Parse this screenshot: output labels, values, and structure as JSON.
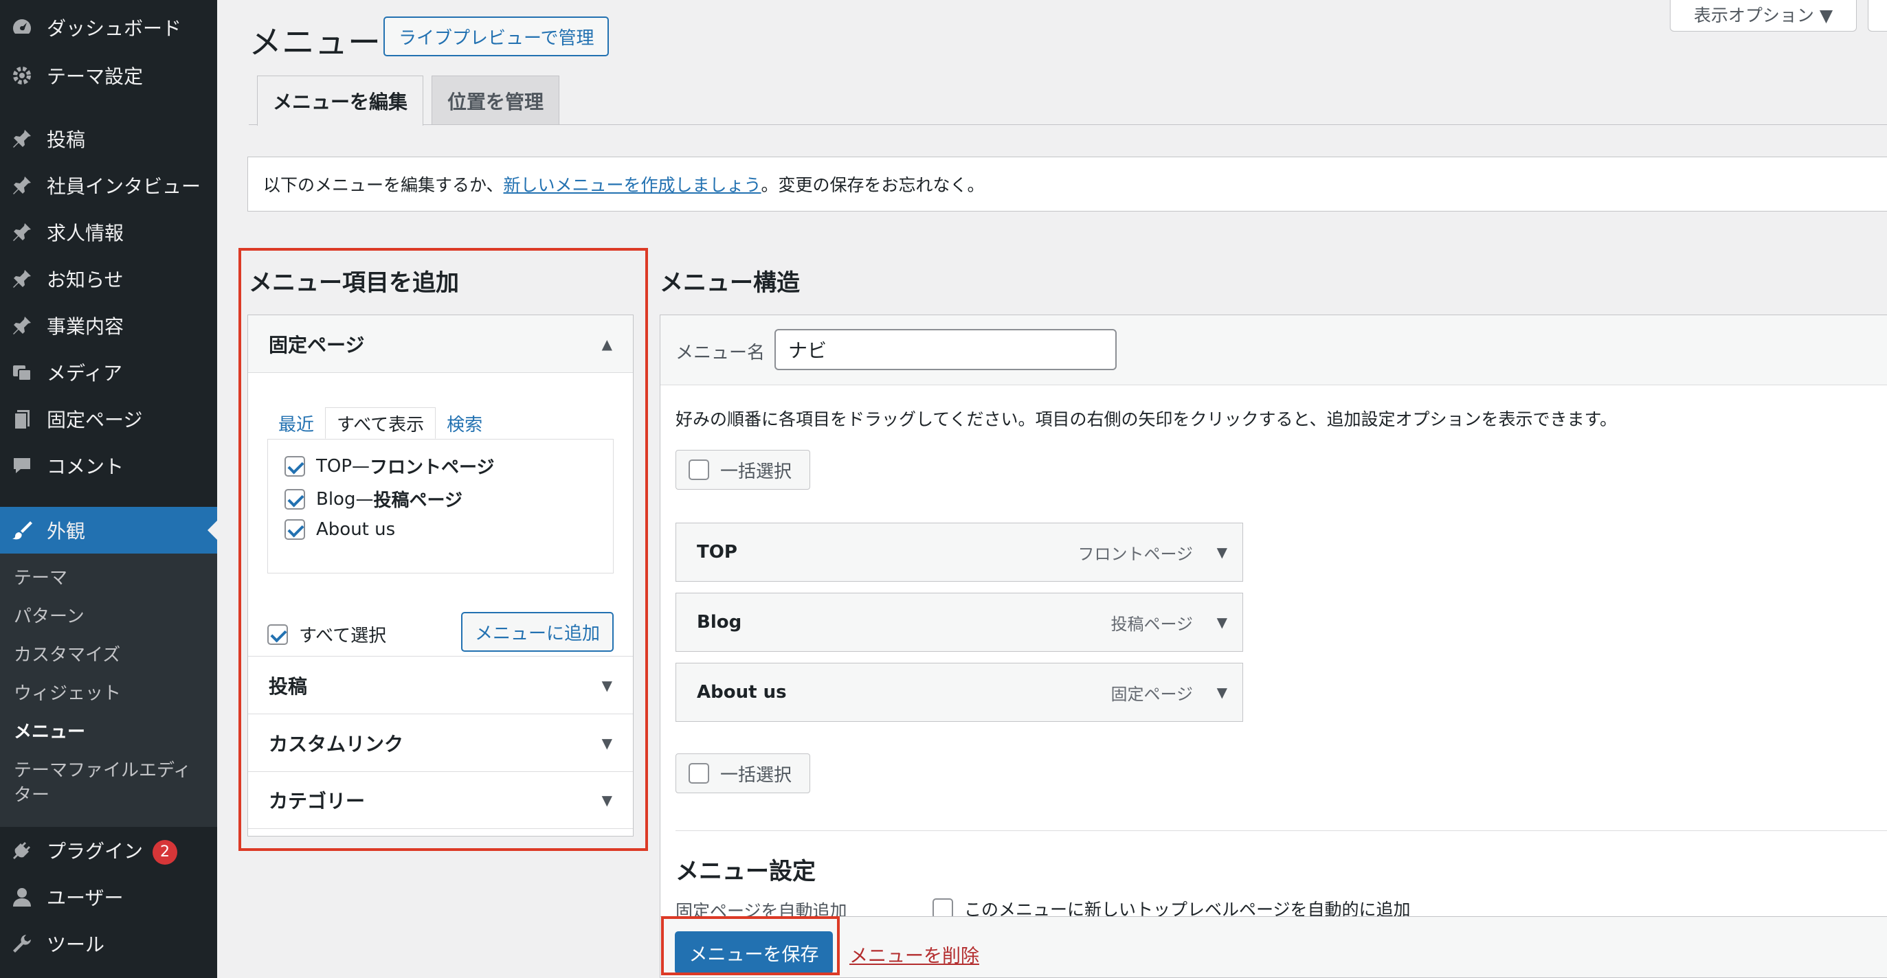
{
  "sidebar": {
    "items": [
      {
        "label": "ダッシュボード",
        "icon": "dashboard-icon"
      },
      {
        "label": "テーマ設定",
        "icon": "gear-icon"
      },
      {
        "label": "投稿",
        "icon": "pin-icon"
      },
      {
        "label": "社員インタビュー",
        "icon": "pin-icon"
      },
      {
        "label": "求人情報",
        "icon": "pin-icon"
      },
      {
        "label": "お知らせ",
        "icon": "pin-icon"
      },
      {
        "label": "事業内容",
        "icon": "pin-icon"
      },
      {
        "label": "メディア",
        "icon": "media-icon"
      },
      {
        "label": "固定ページ",
        "icon": "page-icon"
      },
      {
        "label": "コメント",
        "icon": "comment-icon"
      },
      {
        "label": "外観",
        "icon": "brush-icon"
      },
      {
        "label": "プラグイン",
        "icon": "plugin-icon",
        "badge": "2"
      },
      {
        "label": "ユーザー",
        "icon": "user-icon"
      },
      {
        "label": "ツール",
        "icon": "wrench-icon"
      }
    ],
    "submenu": [
      "テーマ",
      "パターン",
      "カスタマイズ",
      "ウィジェット",
      "メニュー",
      "テーマファイルエディ",
      "ター"
    ]
  },
  "header": {
    "title": "メニュー",
    "live_preview": "ライブプレビューで管理",
    "screen_options": "表示オプション ▼",
    "tabs": [
      "メニューを編集",
      "位置を管理"
    ]
  },
  "notice": {
    "before": "以下のメニューを編集するか、",
    "link": "新しいメニューを作成しましょう",
    "after": "。変更の保存をお忘れなく。"
  },
  "add_items": {
    "title": "メニュー項目を追加",
    "pages_section": "固定ページ",
    "tabs": [
      "最近",
      "すべて表示",
      "検索"
    ],
    "pages": [
      {
        "name": "TOP",
        "sep": " — ",
        "note": "フロントページ",
        "checked": true
      },
      {
        "name": "Blog",
        "sep": " — ",
        "note": "投稿ページ",
        "checked": true
      },
      {
        "name": "About us",
        "sep": "",
        "note": "",
        "checked": true
      }
    ],
    "select_all": "すべて選択",
    "add_button": "メニューに追加",
    "other_sections": [
      "投稿",
      "カスタムリンク",
      "カテゴリー"
    ]
  },
  "structure": {
    "title": "メニュー構造",
    "name_label": "メニュー名",
    "name_value": "ナビ",
    "instructions": "好みの順番に各項目をドラッグしてください。項目の右側の矢印をクリックすると、追加設定オプションを表示できます。",
    "bulk_select": "一括選択",
    "items": [
      {
        "title": "TOP",
        "type": "フロントページ"
      },
      {
        "title": "Blog",
        "type": "投稿ページ"
      },
      {
        "title": "About us",
        "type": "固定ページ"
      }
    ],
    "settings_title": "メニュー設定",
    "auto_add_label": "固定ページを自動追加",
    "auto_add_text": "このメニューに新しいトップレベルページを自動的に追加"
  },
  "footer": {
    "save": "メニューを保存",
    "delete": "メニューを削除"
  },
  "colors": {
    "accent": "#2271b1",
    "sidebar_bg": "#1d2327",
    "highlight": "#dc3a26",
    "badge": "#d63638"
  }
}
